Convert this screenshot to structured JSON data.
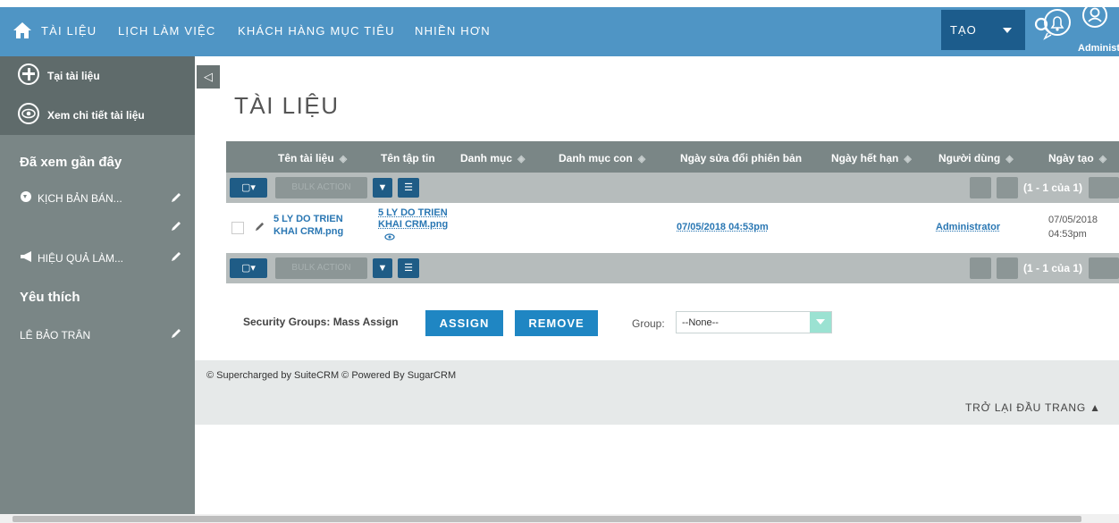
{
  "nav": {
    "items": [
      "TÀI LIỆU",
      "LỊCH LÀM VIỆC",
      "KHÁCH HÀNG MỤC TIÊU",
      "NHIỀN HƠN"
    ],
    "create_label": "TẠO",
    "user_label": "Administ"
  },
  "sidebar": {
    "actions": [
      "Tại tài liệu",
      "Xem chi tiết tài liệu"
    ],
    "recent_heading": "Đã xem gần đây",
    "recent_items": [
      "KỊCH BẢN BÁN...",
      "HIỆU QUẢ LÀM..."
    ],
    "favorites_heading": "Yêu thích",
    "favorites_items": [
      "LÊ BẢO TRÂN"
    ]
  },
  "page": {
    "title": "TÀI LIỆU"
  },
  "table": {
    "headers": [
      "Tên tài liệu",
      "Tên tập tin",
      "Danh mục",
      "Danh mục con",
      "Ngày sửa đổi phiên bản",
      "Ngày hết hạn",
      "Người dùng",
      "Ngày tạo"
    ],
    "bulk_action_label": "BULK ACTION",
    "pagination": "(1 - 1 của 1)",
    "rows": [
      {
        "doc_name_line1": "5 LY DO TRIEN",
        "doc_name_line2": "KHAI CRM.png",
        "file_name_line1": "5 LY DO TRIEN",
        "file_name_line2": "KHAI CRM.png",
        "revision_date": "07/05/2018 04:53pm",
        "user": "Administrator",
        "created_date": "07/05/2018",
        "created_time": "04:53pm"
      }
    ]
  },
  "security": {
    "label": "Security Groups: Mass Assign",
    "assign": "ASSIGN",
    "remove": "REMOVE",
    "group_label": "Group:",
    "group_value": "--None--"
  },
  "footer": {
    "copyright": "© Supercharged by SuiteCRM   © Powered By SugarCRM",
    "back_to_top": "TRỞ LẠI ĐẦU TRANG"
  },
  "colors": {
    "topbar": "#4f95c5",
    "sidebar": "#7a8686",
    "accent": "#1f86c3"
  }
}
